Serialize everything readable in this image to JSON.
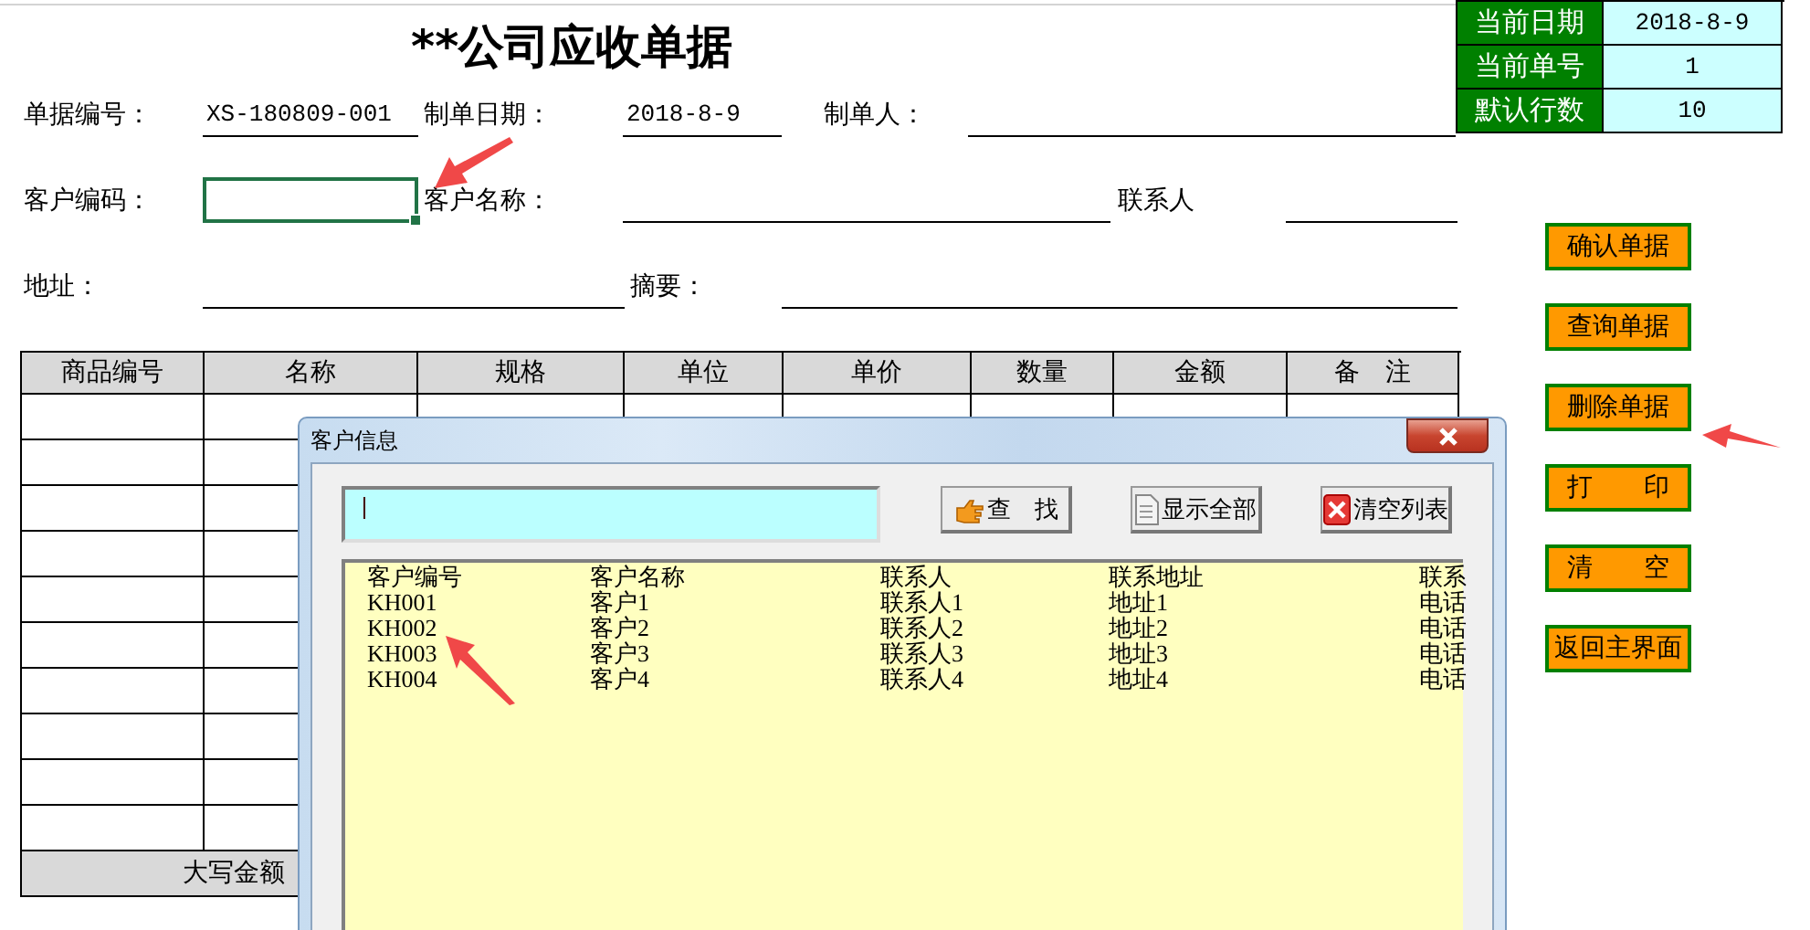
{
  "title": "**公司应收单据",
  "form_rows": [
    [
      {
        "kind": "label",
        "text": "单据编号："
      },
      {
        "kind": "value",
        "text": "XS-180809-001"
      },
      {
        "kind": "label",
        "text": "制单日期："
      },
      {
        "kind": "value",
        "text": "2018-8-9"
      },
      {
        "kind": "label",
        "text": "制单人："
      },
      {
        "kind": "blank"
      }
    ],
    [
      {
        "kind": "label",
        "text": "客户编码："
      },
      {
        "kind": "cell",
        "selected": true
      },
      {
        "kind": "label",
        "text": "客户名称："
      },
      {
        "kind": "blank"
      },
      {
        "kind": "label",
        "text": "联系人"
      },
      {
        "kind": "blank"
      }
    ],
    [
      {
        "kind": "label",
        "text": "地址："
      },
      {
        "kind": "blank"
      },
      {
        "kind": "label",
        "text": "摘要："
      },
      {
        "kind": "blank"
      }
    ]
  ],
  "info": [
    {
      "label": "当前日期",
      "value": "2018-8-9"
    },
    {
      "label": "当前单号",
      "value": "1"
    },
    {
      "label": "默认行数",
      "value": "10"
    }
  ],
  "table": {
    "columns": [
      "商品编号",
      "名称",
      "规格",
      "单位",
      "单价",
      "数量",
      "金额",
      "备　注"
    ],
    "total_label": "大写金额"
  },
  "buttons": [
    "确认单据",
    "查询单据",
    "删除单据",
    "打　　印",
    "清　　空",
    "返回主界面"
  ],
  "dialog": {
    "title": "客户信息",
    "buttons": [
      "查　找",
      "显示全部",
      "清空列表"
    ],
    "list": {
      "columns": [
        "客户编号",
        "客户名称",
        "联系人",
        "联系地址",
        "联系"
      ],
      "rows": [
        [
          "KH001",
          "客户1",
          "联系人1",
          "地址1",
          "电话"
        ],
        [
          "KH002",
          "客户2",
          "联系人2",
          "地址2",
          "电话"
        ],
        [
          "KH003",
          "客户3",
          "联系人3",
          "地址3",
          "电话"
        ],
        [
          "KH004",
          "客户4",
          "联系人4",
          "地址4",
          "电话"
        ]
      ]
    }
  }
}
